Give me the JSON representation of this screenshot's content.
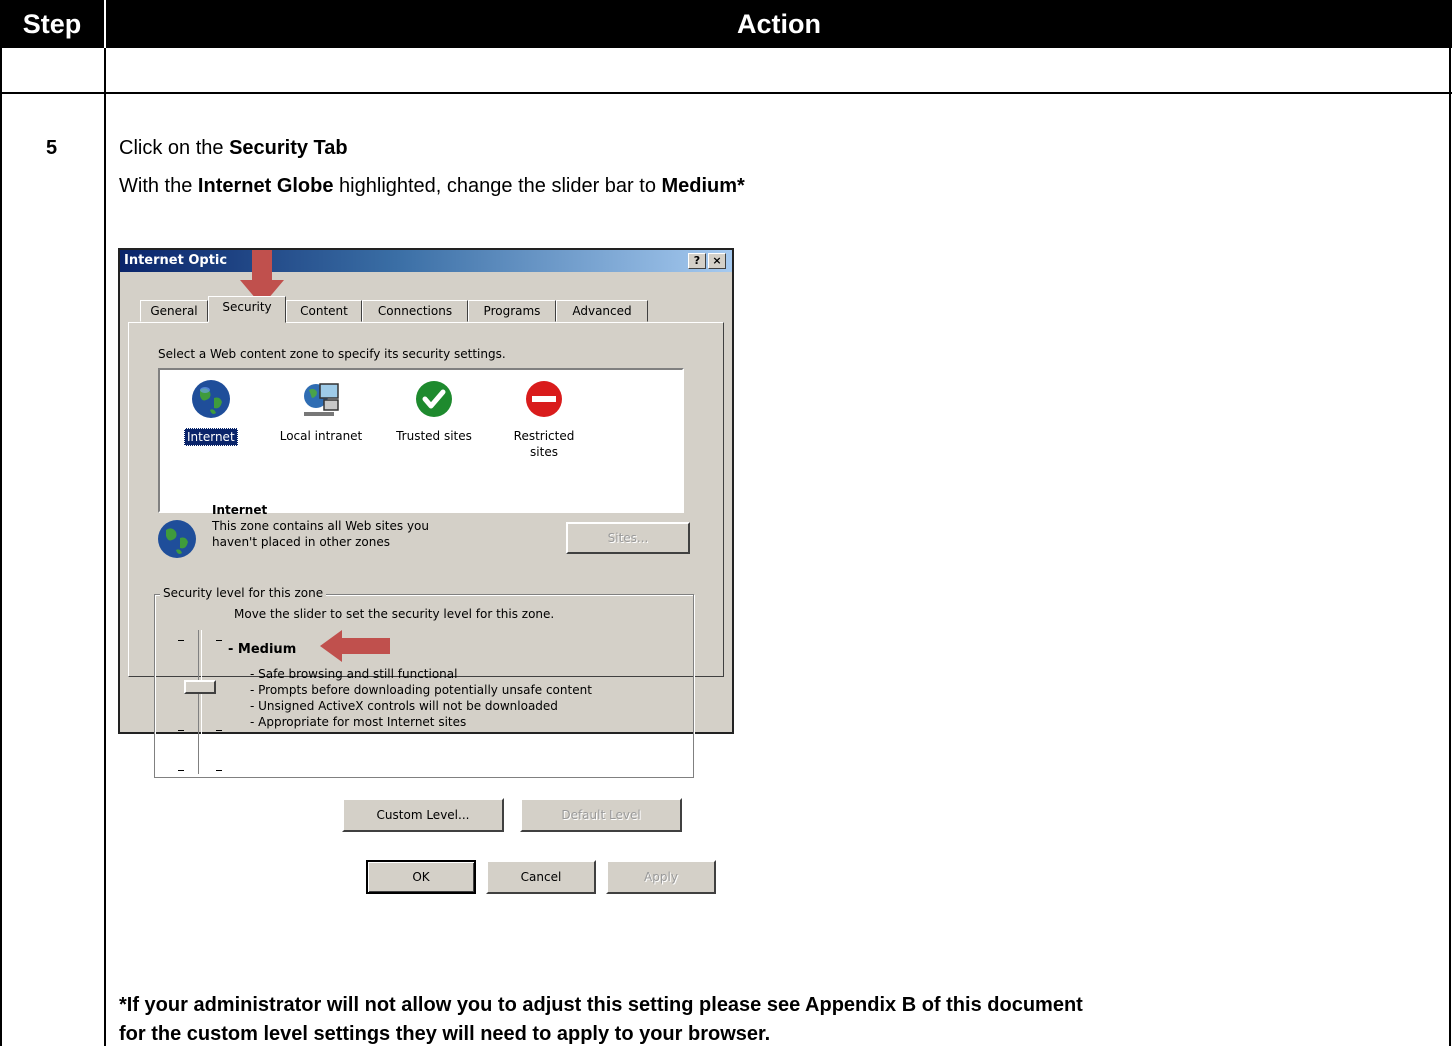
{
  "table": {
    "header_step": "Step",
    "header_action": "Action"
  },
  "step": {
    "number": "5",
    "line1_prefix": "Click on the ",
    "line1_bold": "Security Tab",
    "line2_prefix": "With the ",
    "line2_bold1": "Internet Globe",
    "line2_middle": " highlighted, change the slider bar to ",
    "line2_bold2": "Medium*",
    "footnote_line1": "*If your administrator will not allow you to adjust this setting please see Appendix B of this document",
    "footnote_line2": "for the custom level settings they will need to apply to your browser."
  },
  "dialog": {
    "title": "Internet Optic",
    "help_button": "?",
    "close_button": "×",
    "tabs": [
      "General",
      "Security",
      "Content",
      "Connections",
      "Programs",
      "Advanced"
    ],
    "active_tab": "Security",
    "zone_prompt": "Select a Web content zone to specify its security settings.",
    "zones": [
      {
        "label": "Internet",
        "icon": "globe-icon"
      },
      {
        "label": "Local intranet",
        "icon": "network-computer-icon"
      },
      {
        "label": "Trusted sites",
        "icon": "checkmark-icon"
      },
      {
        "label": "Restricted sites",
        "icon": "no-entry-icon"
      }
    ],
    "selected_zone": "Internet",
    "zone_title": "Internet",
    "zone_desc_line1": "This zone contains all Web sites you",
    "zone_desc_line2": "haven't placed in other zones",
    "sites_button": "Sites...",
    "security_group_label": "Security level for this zone",
    "slider_hint": "Move the slider to set the security level for this zone.",
    "level_name": "- Medium",
    "level_details": [
      "- Safe browsing and still functional",
      "- Prompts before downloading potentially unsafe content",
      "- Unsigned ActiveX controls will not be downloaded",
      "- Appropriate for most Internet sites"
    ],
    "slider_level": "Medium",
    "custom_level_button": "Custom Level...",
    "default_level_button": "Default Level",
    "ok_button": "OK",
    "cancel_button": "Cancel",
    "apply_button": "Apply"
  },
  "colors": {
    "header_bg": "#000000",
    "dialog_face": "#d4d0c8",
    "titlebar_start": "#0a246a",
    "annotation_arrow": "#c0504d",
    "selection": "#0a246a"
  }
}
